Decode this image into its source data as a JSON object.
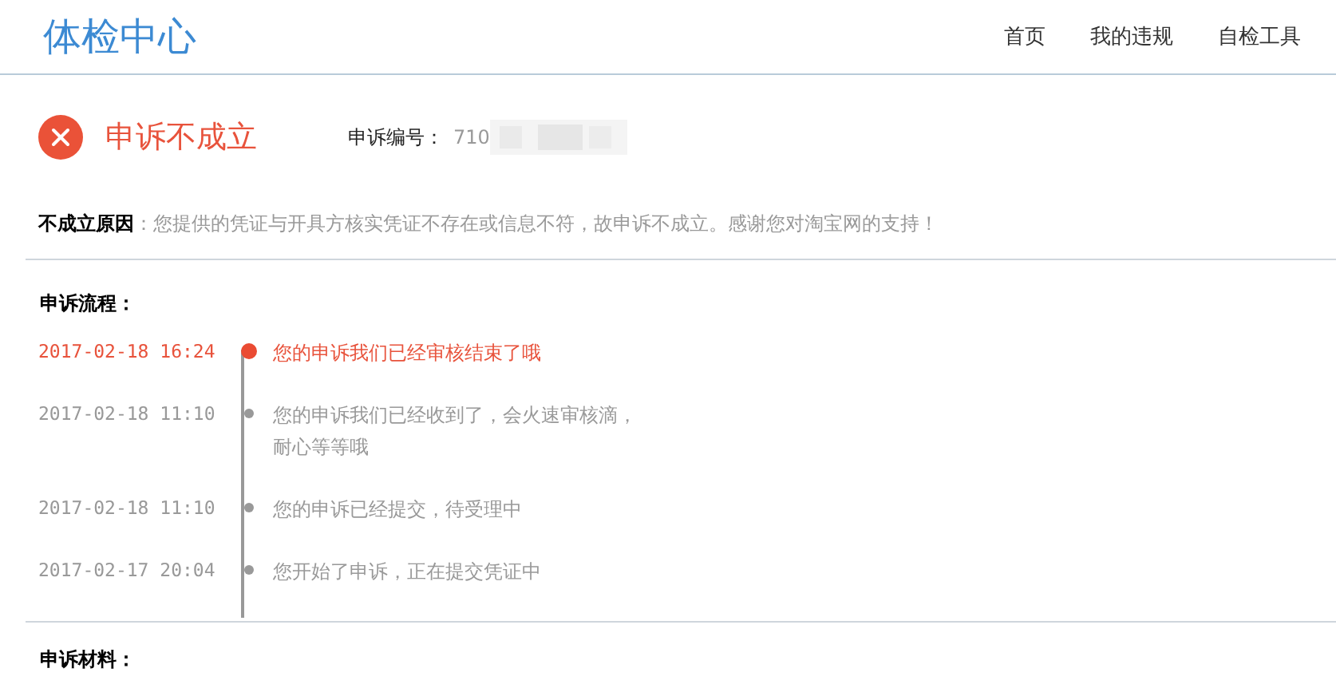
{
  "header": {
    "logo": "体检中心",
    "nav": [
      {
        "label": "首页"
      },
      {
        "label": "我的违规"
      },
      {
        "label": "自检工具"
      }
    ]
  },
  "status": {
    "title": "申诉不成立",
    "number_label": "申诉编号：",
    "number": "710",
    "reason": "**不成立原因**：您提供的凭证与开具方核实凭证不存在或信息不符，故申诉不成立。感谢您对淘宝网的支持！"
  },
  "process": {
    "heading": "申诉流程：",
    "steps": [
      {
        "time": "2017-02-18 16:24",
        "text": "您的申诉我们已经审核结束了哦",
        "current": true
      },
      {
        "time": "2017-02-18 11:10",
        "text": "您的申诉我们已经收到了，会火速审核滴，耐心等等哦",
        "current": false
      },
      {
        "time": "2017-02-18 11:10",
        "text": "您的申诉已经提交，待受理中",
        "current": false
      },
      {
        "time": "2017-02-17 20:04",
        "text": "您开始了申诉，正在提交凭证中",
        "current": false
      }
    ]
  },
  "materials": {
    "heading": "申诉材料："
  }
}
